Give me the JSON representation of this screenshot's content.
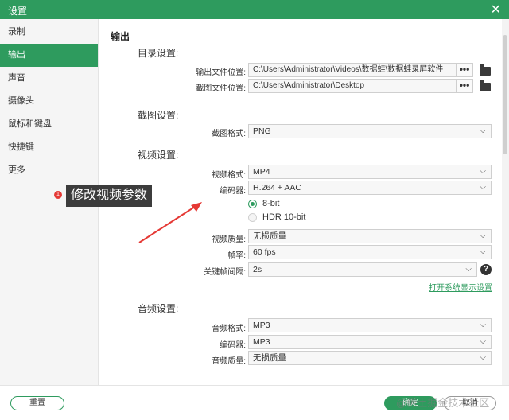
{
  "window": {
    "title": "设置",
    "close_glyph": "✕"
  },
  "sidebar": {
    "items": [
      {
        "label": "录制"
      },
      {
        "label": "输出"
      },
      {
        "label": "声音"
      },
      {
        "label": "摄像头"
      },
      {
        "label": "鼠标和键盘"
      },
      {
        "label": "快捷键"
      },
      {
        "label": "更多"
      }
    ],
    "active_index": 1
  },
  "annotation": {
    "badge": "1",
    "text": "修改视频参数",
    "arrow_color": "#e53935"
  },
  "main": {
    "section_title": "输出",
    "directory": {
      "title": "目录设置:",
      "output_label": "输出文件位置:",
      "output_value": "C:\\Users\\Administrator\\Videos\\数据蛙\\数据蛙录屏软件",
      "screenshot_label": "截图文件位置:",
      "screenshot_value": "C:\\Users\\Administrator\\Desktop",
      "browse_glyph": "•••"
    },
    "screenshot": {
      "title": "截图设置:",
      "format_label": "截图格式:",
      "format_value": "PNG"
    },
    "video": {
      "title": "视频设置:",
      "format_label": "视频格式:",
      "format_value": "MP4",
      "encoder_label": "编码器:",
      "encoder_value": "H.264 + AAC",
      "bitdepth_options": [
        {
          "label": "8-bit",
          "checked": true
        },
        {
          "label": "HDR 10-bit",
          "checked": false
        }
      ],
      "quality_label": "视频质量:",
      "quality_value": "无损质量",
      "fps_label": "帧率:",
      "fps_value": "60 fps",
      "keyframe_label": "关键帧间隔:",
      "keyframe_value": "2s",
      "help_glyph": "?",
      "display_settings_link": "打开系统显示设置"
    },
    "audio": {
      "title": "音频设置:",
      "format_label": "音频格式:",
      "format_value": "MP3",
      "encoder_label": "编码器:",
      "encoder_value": "MP3",
      "quality_label": "音频质量:",
      "quality_value": "无损质量"
    }
  },
  "footer": {
    "reset_label": "重置",
    "ok_label": "确定",
    "cancel_label": "取消",
    "watermark": "@稀土掘金技术社区"
  },
  "colors": {
    "accent": "#2e9b5e",
    "badge": "#e53935"
  }
}
